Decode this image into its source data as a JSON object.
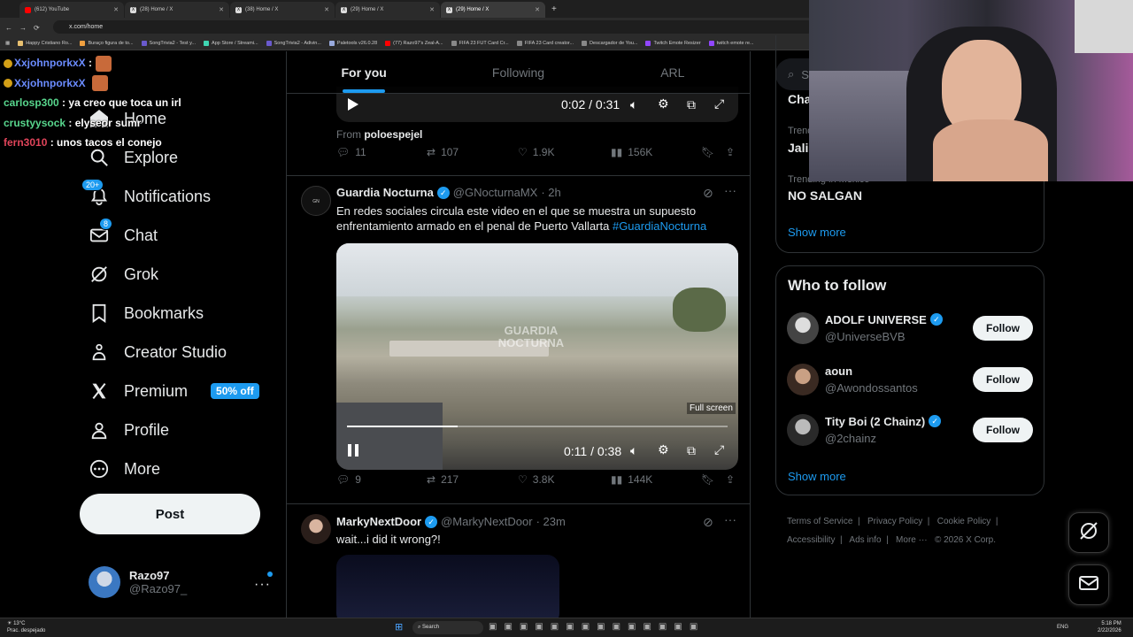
{
  "browser": {
    "tabs": [
      {
        "label": "(612) YouTube",
        "icon": "youtube-icon"
      },
      {
        "label": "(28) Home / X",
        "icon": "x-icon"
      },
      {
        "label": "(38) Home / X",
        "icon": "x-icon"
      },
      {
        "label": "(29) Home / X",
        "icon": "x-icon"
      },
      {
        "label": "(29) Home / X",
        "icon": "x-icon"
      }
    ],
    "url": "x.com/home",
    "bookmarks": [
      "Happy Cristiano Ro...",
      "Buraço figura de to...",
      "SongTrivia2 - Test y...",
      "App Store / Streami...",
      "SongTrivia2 - Adivin...",
      "Paletools v26.0.28",
      "(77) Razo97's Zeal-A...",
      "FIFA 23 FUT Card Cr...",
      "FIFA 23 Card creator...",
      "Descargador de You...",
      "Twitch Emote Resizer",
      "twitch emote re..."
    ]
  },
  "chat": [
    {
      "user": "XxjohnporkxX",
      "message": ":"
    },
    {
      "user": "XxjohnporkxX",
      "message": ""
    },
    {
      "user": "carlosp300",
      "message": "ya creo que toca un irl"
    },
    {
      "user": "crustyysock",
      "message": "elyseor sumr"
    },
    {
      "user": "fern3010",
      "message": "unos tacos el conejo"
    }
  ],
  "nav": {
    "items": [
      {
        "label": "Home",
        "icon": "home-icon"
      },
      {
        "label": "Explore",
        "icon": "search-icon"
      },
      {
        "label": "Notifications",
        "icon": "bell-icon",
        "badge": "20+"
      },
      {
        "label": "Chat",
        "icon": "mail-icon",
        "badge": "8"
      },
      {
        "label": "Grok",
        "icon": "grok-icon"
      },
      {
        "label": "Bookmarks",
        "icon": "bookmark-icon"
      },
      {
        "label": "Creator Studio",
        "icon": "creator-studio-icon"
      },
      {
        "label": "Premium",
        "icon": "x-logo-icon",
        "tag": "50% off"
      },
      {
        "label": "Profile",
        "icon": "person-icon"
      },
      {
        "label": "More",
        "icon": "more-circle-icon"
      }
    ],
    "post_label": "Post",
    "account": {
      "name": "Razo97",
      "handle": "@Razo97_"
    }
  },
  "feed": {
    "tabs": [
      "For you",
      "Following",
      "ARL"
    ],
    "tweet1": {
      "video_time": "0:02 / 0:31",
      "from_label": "From",
      "from_user": "poloespejel",
      "replies": "11",
      "reposts": "107",
      "likes": "1.9K",
      "views": "156K"
    },
    "tweet2": {
      "name": "Guardia Nocturna",
      "handle": "@GNocturnaMX",
      "time": "· 2h",
      "text": "En redes sociales circula este video en el que se muestra un supuesto enfrentamiento armado en el penal de Puerto Vallarta",
      "hashtag": "#GuardiaNocturna",
      "watermark": "GUARDIA NOCTURNA",
      "fullscreen_tip": "Full screen",
      "video_time": "0:11 / 0:38",
      "progress": 0.29,
      "replies": "9",
      "reposts": "217",
      "likes": "3.8K",
      "views": "144K"
    },
    "tweet3": {
      "name": "MarkyNextDoor",
      "handle": "@MarkyNextDoor",
      "time": "· 23m",
      "text": "wait...i did it wrong?!"
    }
  },
  "right": {
    "search_placeholder": "Se",
    "trends": [
      {
        "context": "",
        "name": "Cha"
      },
      {
        "context": "Trend",
        "name": "Jalis"
      },
      {
        "context": "Trending in Mexico",
        "name": "NO SALGAN"
      }
    ],
    "show_more": "Show more",
    "who_to_follow_title": "Who to follow",
    "follow_label": "Follow",
    "suggestions": [
      {
        "name": "ADOLF UNIVERSE",
        "handle": "@UniverseBVB",
        "verified": true
      },
      {
        "name": "aoun",
        "handle": "@Awondossantos",
        "verified": false
      },
      {
        "name": "Tity Boi (2 Chainz)",
        "handle": "@2chainz",
        "verified": true
      }
    ],
    "footer": [
      "Terms of Service",
      "Privacy Policy",
      "Cookie Policy",
      "Accessibility",
      "Ads info",
      "More ···",
      "© 2026 X Corp."
    ]
  },
  "taskbar": {
    "weather_temp": "13°C",
    "weather_desc": "Prac. despejado",
    "search": "Search",
    "lang": "ENG",
    "time": "5:18 PM",
    "date": "2/22/2026"
  },
  "colors": {
    "accent": "#1d9bf0",
    "bg": "#000000",
    "border": "#2f3336",
    "muted": "#71767b"
  }
}
